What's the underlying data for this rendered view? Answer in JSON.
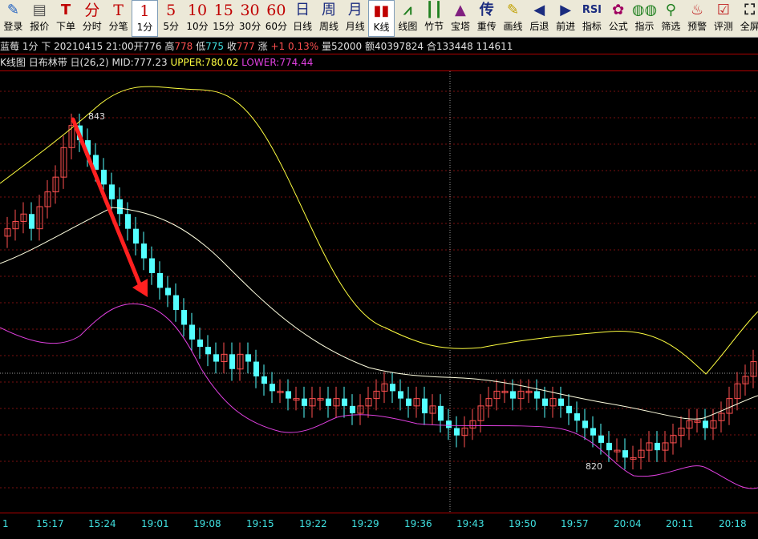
{
  "toolbar": [
    {
      "icon": "✎",
      "label": "登录",
      "name": "login-button",
      "kind": "sym",
      "color": "#2060c0"
    },
    {
      "icon": "▤",
      "label": "报价",
      "name": "quote-button",
      "kind": "sym",
      "color": "#505050"
    },
    {
      "icon": "T",
      "label": "下单",
      "name": "order-button",
      "kind": "sym",
      "color": "#c00000"
    },
    {
      "icon": "分",
      "label": "分时",
      "name": "timeshare-button",
      "kind": "period"
    },
    {
      "icon": "T",
      "label": "分笔",
      "name": "tick-button",
      "kind": "period"
    },
    {
      "icon": "1",
      "label": "1分",
      "name": "period-1min-button",
      "kind": "period",
      "selected": true
    },
    {
      "icon": "5",
      "label": "5分",
      "name": "period-5min-button",
      "kind": "period"
    },
    {
      "icon": "10",
      "label": "10分",
      "name": "period-10min-button",
      "kind": "period"
    },
    {
      "icon": "15",
      "label": "15分",
      "name": "period-15min-button",
      "kind": "period"
    },
    {
      "icon": "30",
      "label": "30分",
      "name": "period-30min-button",
      "kind": "period"
    },
    {
      "icon": "60",
      "label": "60分",
      "name": "period-60min-button",
      "kind": "period"
    },
    {
      "icon": "日",
      "label": "日线",
      "name": "period-day-button",
      "kind": "cal"
    },
    {
      "icon": "周",
      "label": "周线",
      "name": "period-week-button",
      "kind": "cal"
    },
    {
      "icon": "月",
      "label": "月线",
      "name": "period-month-button",
      "kind": "cal"
    },
    {
      "icon": "▮▮",
      "label": "K线",
      "name": "kline-button",
      "kind": "sym",
      "color": "#c00000",
      "selected": true
    },
    {
      "icon": "⩘",
      "label": "线图",
      "name": "linechart-button",
      "kind": "sym",
      "color": "#208020"
    },
    {
      "icon": "┃┃",
      "label": "竹节",
      "name": "bamboo-button",
      "kind": "sym",
      "color": "#208020"
    },
    {
      "icon": "▲",
      "label": "宝塔",
      "name": "tower-button",
      "kind": "sym",
      "color": "#802080"
    },
    {
      "icon": "传",
      "label": "重传",
      "name": "reload-button",
      "kind": "sym",
      "color": "#1b2c7f"
    },
    {
      "icon": "✎",
      "label": "画线",
      "name": "draw-button",
      "kind": "sym",
      "color": "#c0a000"
    },
    {
      "icon": "◀",
      "label": "后退",
      "name": "back-button",
      "kind": "sym",
      "color": "#1b2c7f"
    },
    {
      "icon": "▶",
      "label": "前进",
      "name": "forward-button",
      "kind": "sym",
      "color": "#1b2c7f"
    },
    {
      "icon": "RSI",
      "label": "指标",
      "name": "indicator-button",
      "kind": "sym",
      "color": "#1b2c7f"
    },
    {
      "icon": "✿",
      "label": "公式",
      "name": "formula-button",
      "kind": "sym",
      "color": "#a00060"
    },
    {
      "icon": "◍◍",
      "label": "指示",
      "name": "indicate-button",
      "kind": "sym",
      "color": "#208020"
    },
    {
      "icon": "⚲",
      "label": "筛选",
      "name": "filter-button",
      "kind": "sym",
      "color": "#208020"
    },
    {
      "icon": "♨",
      "label": "预警",
      "name": "alert-button",
      "kind": "sym",
      "color": "#c02020"
    },
    {
      "icon": "☑",
      "label": "评测",
      "name": "evaluate-button",
      "kind": "sym",
      "color": "#c02020"
    },
    {
      "icon": "⛶",
      "label": "全屏",
      "name": "fullscreen-button",
      "kind": "sym",
      "color": "#202020"
    }
  ],
  "info": {
    "symbol": "蓝莓",
    "period": "1分",
    "direction": "下",
    "datetime": "20210415 21:00",
    "open_label": "开",
    "open": "776",
    "high_label": "高",
    "high": "778",
    "low_label": "低",
    "low": "775",
    "close_label": "收",
    "close": "777",
    "change_label": "涨",
    "change": "+1 0.13%",
    "volume_label": "量",
    "volume": "52000",
    "amount_label": "额",
    "amount": "40397824",
    "oi_label": "合",
    "oi": "133448",
    "extra": "114611"
  },
  "indicator": {
    "chart_label": "K线图",
    "name": "日布林带",
    "scope": "日(26,2)",
    "mid_label": "MID:",
    "mid": "777.23",
    "upper_label": "UPPER:",
    "upper": "780.02",
    "lower_label": "LOWER:",
    "lower": "774.44"
  },
  "chart_labels": {
    "high_mark": "843",
    "low_mark": "820"
  },
  "xaxis": [
    "1",
    "15:17",
    "15:24",
    "19:01",
    "19:08",
    "19:15",
    "19:22",
    "19:29",
    "19:36",
    "19:43",
    "19:50",
    "19:57",
    "20:04",
    "20:11",
    "20:18"
  ],
  "colors": {
    "up": "#ff5050",
    "down": "#54ffff",
    "upper_band": "#ffff40",
    "mid_band": "#ffffe0",
    "lower_band": "#e040e0",
    "arrow": "#ff2020"
  },
  "chart_data": {
    "type": "candlestick",
    "series_close": [
      829,
      830,
      831,
      829,
      832,
      834,
      836,
      840,
      843,
      841,
      839,
      837,
      835,
      833,
      831,
      829,
      827,
      825,
      823,
      821,
      820,
      818,
      816,
      814,
      813,
      812,
      811,
      812,
      810,
      812,
      811,
      809,
      808,
      807,
      807,
      806,
      806,
      805,
      806,
      806,
      805,
      806,
      805,
      804,
      805,
      806,
      807,
      808,
      807,
      806,
      805,
      806,
      804,
      805,
      803,
      802,
      801,
      802,
      803,
      805,
      806,
      807,
      807,
      806,
      807,
      807,
      806,
      805,
      806,
      805,
      804,
      803,
      802,
      801,
      800,
      799,
      799,
      798,
      798,
      799,
      800,
      799,
      800,
      801,
      802,
      803,
      803,
      802,
      803,
      804,
      806,
      808,
      809,
      811,
      812
    ]
  }
}
